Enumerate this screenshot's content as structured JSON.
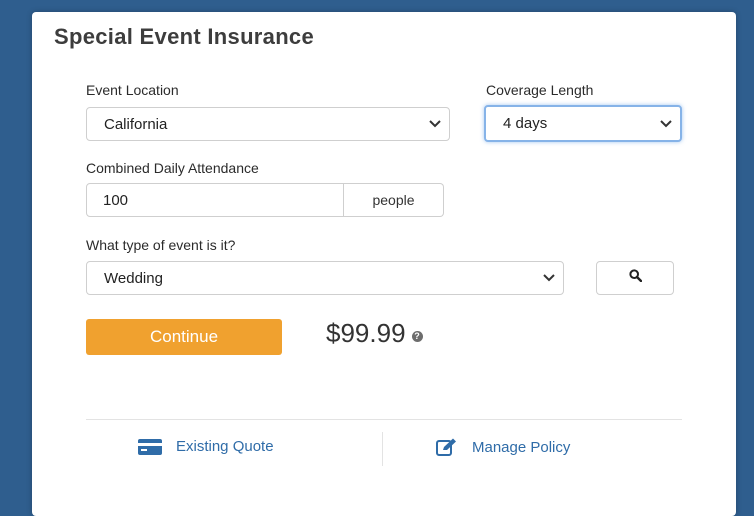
{
  "form": {
    "title": "Special Event Insurance",
    "location": {
      "label": "Event Location",
      "value": "California"
    },
    "coverage": {
      "label": "Coverage Length",
      "value": "4 days"
    },
    "attendance": {
      "label": "Combined Daily Attendance",
      "value": "100",
      "unit": "people"
    },
    "event_type": {
      "label": "What type of event is it?",
      "value": "Wedding"
    },
    "continue_label": "Continue",
    "price": "$99.99"
  },
  "footer": {
    "existing_quote": "Existing Quote",
    "manage_policy": "Manage Policy"
  },
  "colors": {
    "background": "#2f5e8e",
    "accent": "#f0a12f",
    "link": "#2f6ca8",
    "focus": "#86b3e8"
  },
  "icons": {
    "help": "question-circle-icon",
    "search": "search-icon",
    "chevron": "chevron-down-icon",
    "existing_quote": "credit-card-icon",
    "manage_policy": "edit-icon"
  }
}
